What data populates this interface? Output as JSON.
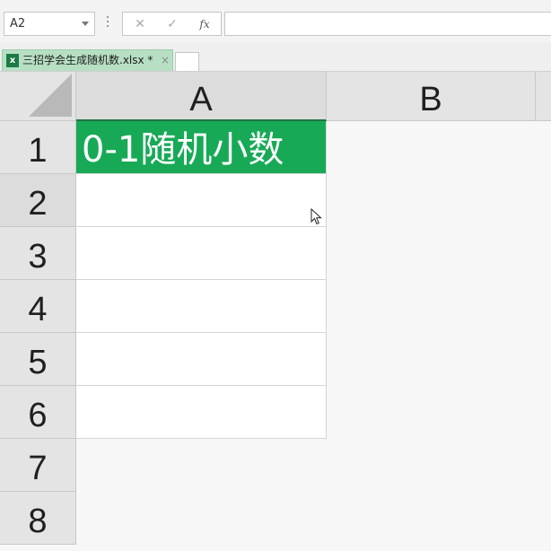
{
  "formula_bar": {
    "name_box": "A2",
    "cancel_symbol": "✕",
    "enter_symbol": "✓",
    "fx_symbol": "fx",
    "formula_value": ""
  },
  "workbook_tab": {
    "icon_letter": "x",
    "title": "三招学会生成随机数.xlsx *",
    "close_symbol": "×"
  },
  "columns": [
    "A",
    "B"
  ],
  "rows": [
    "1",
    "2",
    "3",
    "4",
    "5",
    "6",
    "7",
    "8"
  ],
  "cells": {
    "A1": "0-1随机小数",
    "A1_fill": "#18a957"
  },
  "selected_cell": "A2"
}
